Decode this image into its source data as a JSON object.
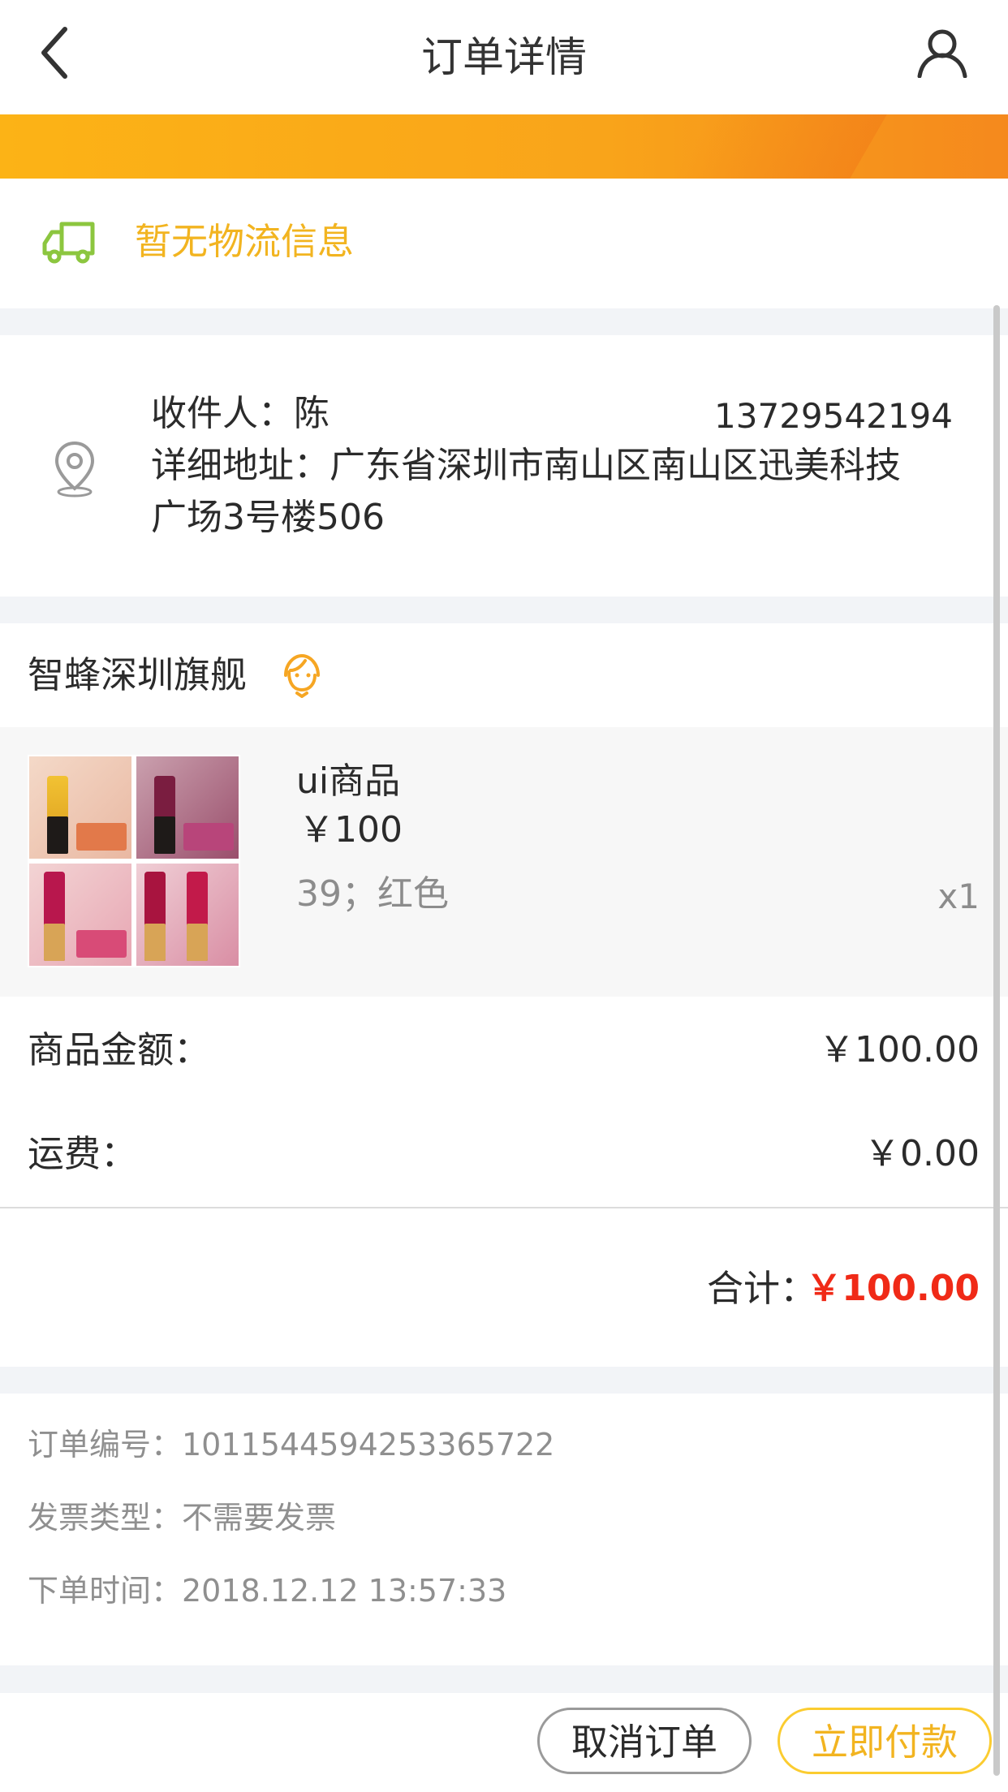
{
  "header": {
    "title": "订单详情",
    "back_icon": "chevron-left-icon",
    "user_icon": "user-icon"
  },
  "logistics": {
    "icon": "truck-icon",
    "text": "暂无物流信息",
    "icon_color": "#8cc63f",
    "text_color": "#f2b420"
  },
  "address": {
    "icon": "location-pin-icon",
    "recipient": "收件人：陈",
    "phone": "13729542194",
    "detail_line1": "详细地址：广东省深圳市南山区南山区迅美科技",
    "detail_line2": "广场3号楼506"
  },
  "store": {
    "name": "智蜂深圳旗舰",
    "service_icon": "customer-service-icon"
  },
  "product": {
    "name": "ui商品",
    "price": "￥100",
    "spec": "39；红色",
    "quantity": "x1"
  },
  "amounts": {
    "goods_label": "商品金额：",
    "goods_value": "￥100.00",
    "shipping_label": "运费：",
    "shipping_value": "￥0.00",
    "total_label": "合计：",
    "total_value": "￥100.00",
    "total_color": "#f02a17"
  },
  "order_info": {
    "order_no": "订单编号：1011544594253365722",
    "invoice": "发票类型：不需要发票",
    "time": "下单时间：2018.12.12 13:57:33"
  },
  "footer": {
    "cancel_label": "取消订单",
    "pay_label": "立即付款",
    "accent_color": "#fbcc30"
  }
}
